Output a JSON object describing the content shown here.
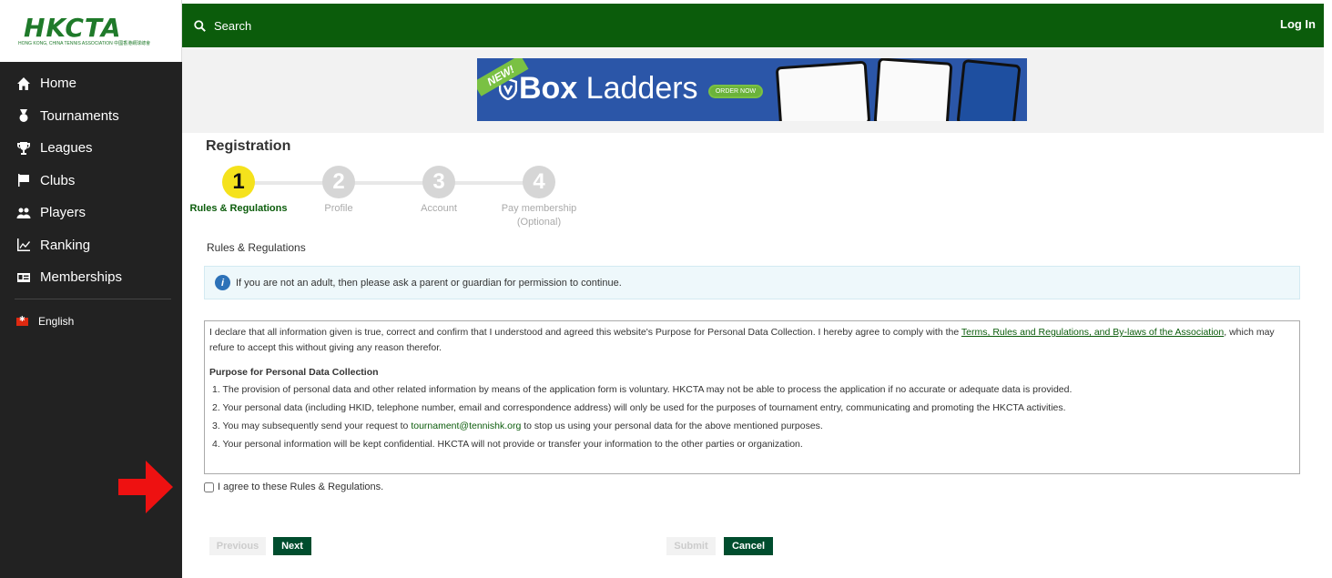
{
  "app": {
    "logo_text": "HKCTA",
    "logo_subtitle": "HONG KONG, CHINA TENNIS ASSOCIATION 中國香港網球總會"
  },
  "sidebar": {
    "items": [
      {
        "label": "Home",
        "icon": "home-icon"
      },
      {
        "label": "Tournaments",
        "icon": "medal-icon"
      },
      {
        "label": "Leagues",
        "icon": "trophy-icon"
      },
      {
        "label": "Clubs",
        "icon": "flag-icon"
      },
      {
        "label": "Players",
        "icon": "users-icon"
      },
      {
        "label": "Ranking",
        "icon": "chart-icon"
      },
      {
        "label": "Memberships",
        "icon": "id-card-icon"
      }
    ],
    "language": "English"
  },
  "topbar": {
    "search_label": "Search",
    "login_label": "Log In"
  },
  "banner": {
    "badge": "NEW!",
    "title_bold": "Box",
    "title_rest": " Ladders",
    "cta": "ORDER NOW"
  },
  "page": {
    "title": "Registration",
    "steps": [
      {
        "number": "1",
        "label": "Rules & Regulations",
        "active": true
      },
      {
        "number": "2",
        "label": "Profile",
        "active": false
      },
      {
        "number": "3",
        "label": "Account",
        "active": false
      },
      {
        "number": "4",
        "label": "Pay membership (Optional)",
        "active": false
      }
    ],
    "section_title": "Rules & Regulations",
    "info_message": "If you are not an adult, then please ask a parent or guardian for permission to continue.",
    "terms": {
      "intro_before_link": "I declare that all information given is true, correct and confirm that I understood and agreed this website's Purpose for Personal Data Collection. I hereby agree to comply with the ",
      "link_text": "Terms, Rules and Regulations, and By-laws of the Association",
      "intro_after_link": ", which may refure to accept this without giving any reason therefor.",
      "heading": "Purpose for Personal Data Collection",
      "item1": "1. The provision of personal data and other related information by means of the application form is voluntary. HKCTA may not be able to process the application if no accurate or adequate data is provided.",
      "item2": "2. Your personal data (including HKID, telephone number, email and correspondence address) will only be used for the purposes of tournament entry, communicating and promoting the HKCTA activities.",
      "item3_before": "3. You may subsequently send your request to ",
      "item3_email": "tournament@tennishk.org",
      "item3_after": " to stop us using your personal data for the above mentioned purposes.",
      "item4": "4. Your personal information will be kept confidential. HKCTA will not provide or transfer your information to the other parties or organization."
    },
    "agree_label": "I agree to these Rules & Regulations.",
    "buttons": {
      "previous": "Previous",
      "next": "Next",
      "submit": "Submit",
      "cancel": "Cancel"
    }
  },
  "colors": {
    "brand_green": "#0b5c0b",
    "sidebar_bg": "#222222",
    "active_step": "#f5e21c",
    "primary_button": "#004d2e"
  }
}
